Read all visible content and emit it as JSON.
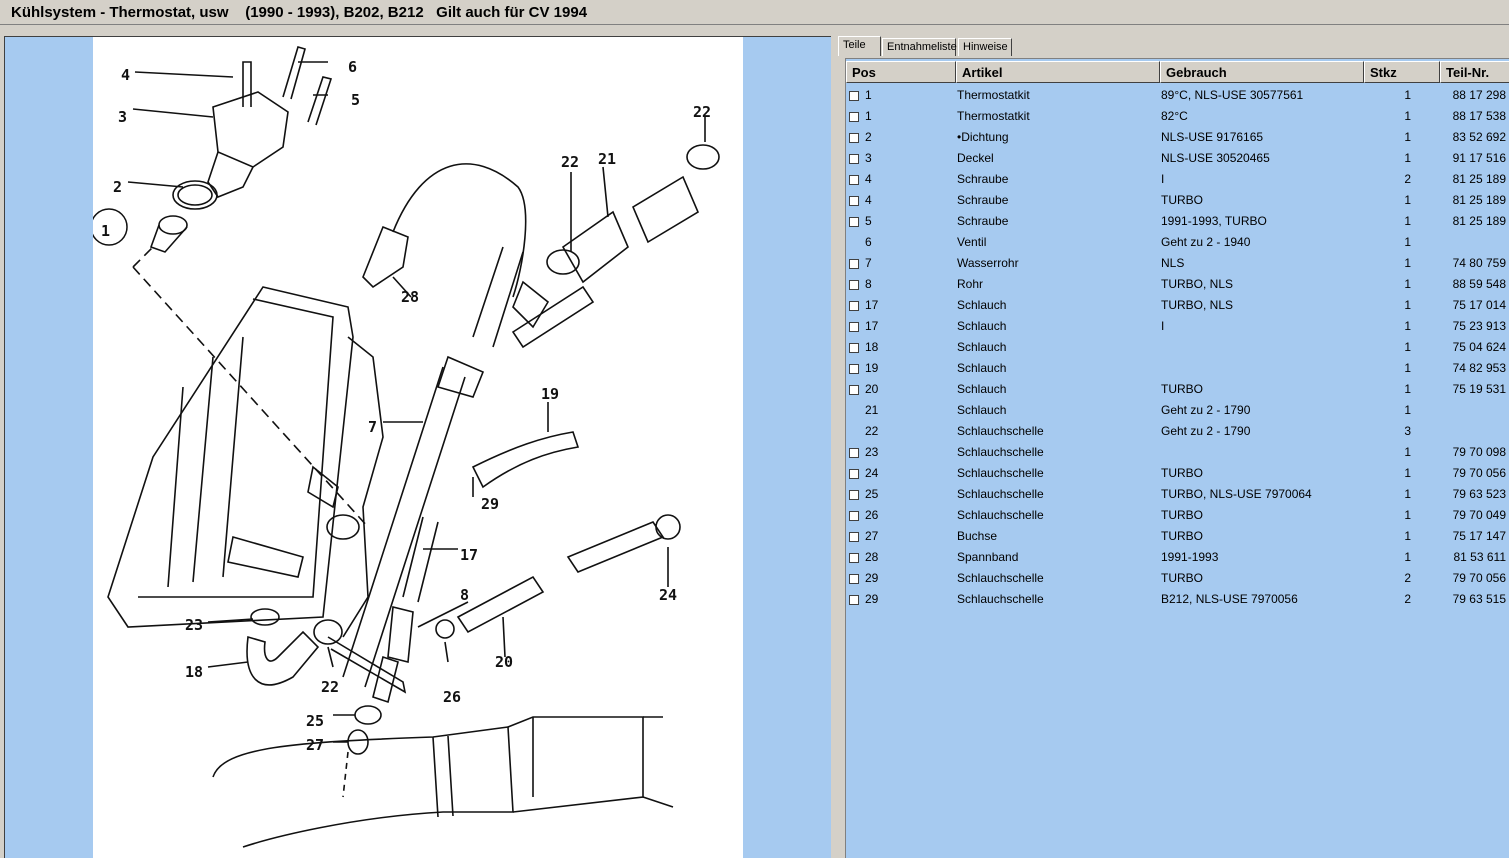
{
  "window": {
    "title": "Kühlsystem - Thermostat, usw    (1990 - 1993), B202, B212   Gilt auch für CV 1994"
  },
  "tabs": [
    {
      "label": "Teile"
    },
    {
      "label": "Entnahmeliste"
    },
    {
      "label": "Hinweise"
    }
  ],
  "table": {
    "headers": {
      "pos": "Pos",
      "artikel": "Artikel",
      "gebrauch": "Gebrauch",
      "stkz": "Stkz",
      "teilnr": "Teil-Nr."
    },
    "rows": [
      {
        "checkbox": true,
        "pos": "1",
        "artikel": "Thermostatkit",
        "gebrauch": "89°C, NLS-USE 30577561",
        "stkz": "1",
        "teilnr": "88 17 298"
      },
      {
        "checkbox": true,
        "pos": "1",
        "artikel": "Thermostatkit",
        "gebrauch": "82°C",
        "stkz": "1",
        "teilnr": "88 17 538"
      },
      {
        "checkbox": true,
        "pos": "2",
        "artikel": "•Dichtung",
        "gebrauch": "NLS-USE 9176165",
        "stkz": "1",
        "teilnr": "83 52 692"
      },
      {
        "checkbox": true,
        "pos": "3",
        "artikel": "Deckel",
        "gebrauch": "NLS-USE 30520465",
        "stkz": "1",
        "teilnr": "91 17 516"
      },
      {
        "checkbox": true,
        "pos": "4",
        "artikel": "Schraube",
        "gebrauch": "I",
        "stkz": "2",
        "teilnr": "81 25 189"
      },
      {
        "checkbox": true,
        "pos": "4",
        "artikel": "Schraube",
        "gebrauch": "TURBO",
        "stkz": "1",
        "teilnr": "81 25 189"
      },
      {
        "checkbox": true,
        "pos": "5",
        "artikel": "Schraube",
        "gebrauch": "1991-1993, TURBO",
        "stkz": "1",
        "teilnr": "81 25 189"
      },
      {
        "checkbox": false,
        "pos": "6",
        "artikel": "Ventil",
        "gebrauch": "Geht zu 2 - 1940",
        "stkz": "1",
        "teilnr": ""
      },
      {
        "checkbox": true,
        "pos": "7",
        "artikel": "Wasserrohr",
        "gebrauch": "NLS",
        "stkz": "1",
        "teilnr": "74 80 759"
      },
      {
        "checkbox": true,
        "pos": "8",
        "artikel": "Rohr",
        "gebrauch": "TURBO, NLS",
        "stkz": "1",
        "teilnr": "88 59 548"
      },
      {
        "checkbox": true,
        "pos": "17",
        "artikel": "Schlauch",
        "gebrauch": "TURBO, NLS",
        "stkz": "1",
        "teilnr": "75 17 014"
      },
      {
        "checkbox": true,
        "pos": "17",
        "artikel": "Schlauch",
        "gebrauch": "I",
        "stkz": "1",
        "teilnr": "75 23 913"
      },
      {
        "checkbox": true,
        "pos": "18",
        "artikel": "Schlauch",
        "gebrauch": "",
        "stkz": "1",
        "teilnr": "75 04 624"
      },
      {
        "checkbox": true,
        "pos": "19",
        "artikel": "Schlauch",
        "gebrauch": "",
        "stkz": "1",
        "teilnr": "74 82 953"
      },
      {
        "checkbox": true,
        "pos": "20",
        "artikel": "Schlauch",
        "gebrauch": "TURBO",
        "stkz": "1",
        "teilnr": "75 19 531"
      },
      {
        "checkbox": false,
        "pos": "21",
        "artikel": "Schlauch",
        "gebrauch": "Geht zu 2 - 1790",
        "stkz": "1",
        "teilnr": ""
      },
      {
        "checkbox": false,
        "pos": "22",
        "artikel": "Schlauchschelle",
        "gebrauch": "Geht zu 2 - 1790",
        "stkz": "3",
        "teilnr": ""
      },
      {
        "checkbox": true,
        "pos": "23",
        "artikel": "Schlauchschelle",
        "gebrauch": "",
        "stkz": "1",
        "teilnr": "79 70 098"
      },
      {
        "checkbox": true,
        "pos": "24",
        "artikel": "Schlauchschelle",
        "gebrauch": "TURBO",
        "stkz": "1",
        "teilnr": "79 70 056"
      },
      {
        "checkbox": true,
        "pos": "25",
        "artikel": "Schlauchschelle",
        "gebrauch": "TURBO, NLS-USE 7970064",
        "stkz": "1",
        "teilnr": "79 63 523"
      },
      {
        "checkbox": true,
        "pos": "26",
        "artikel": "Schlauchschelle",
        "gebrauch": "TURBO",
        "stkz": "1",
        "teilnr": "79 70 049"
      },
      {
        "checkbox": true,
        "pos": "27",
        "artikel": "Buchse",
        "gebrauch": "TURBO",
        "stkz": "1",
        "teilnr": "75 17 147"
      },
      {
        "checkbox": true,
        "pos": "28",
        "artikel": "Spannband",
        "gebrauch": "1991-1993",
        "stkz": "1",
        "teilnr": "81 53 611"
      },
      {
        "checkbox": true,
        "pos": "29",
        "artikel": "Schlauchschelle",
        "gebrauch": "TURBO",
        "stkz": "2",
        "teilnr": "79 70 056"
      },
      {
        "checkbox": true,
        "pos": "29",
        "artikel": "Schlauchschelle",
        "gebrauch": "B212, NLS-USE 7970056",
        "stkz": "2",
        "teilnr": "79 63 515"
      }
    ]
  },
  "diagram": {
    "callouts": [
      "4",
      "6",
      "5",
      "3",
      "2",
      "1",
      "22",
      "22",
      "21",
      "28",
      "19",
      "7",
      "29",
      "17",
      "8",
      "24",
      "23",
      "18",
      "22",
      "26",
      "20",
      "25",
      "27"
    ]
  },
  "colors": {
    "pane_background": "#a6caf0",
    "chrome": "#d4d0c8"
  }
}
